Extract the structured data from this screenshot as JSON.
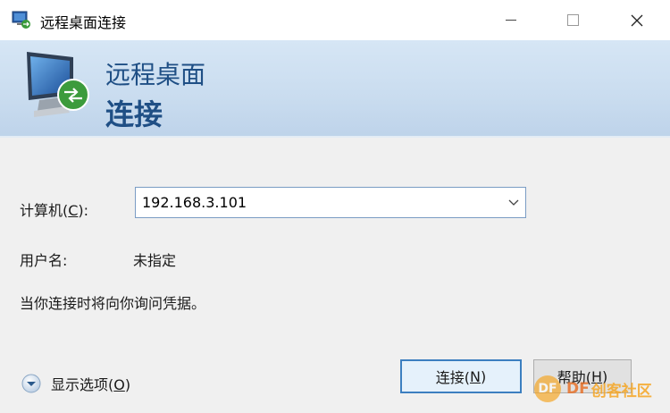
{
  "window": {
    "title": "远程桌面连接",
    "icon": "remote-desktop-icon",
    "controls": {
      "minimize": "minimize-icon",
      "maximize": "maximize-icon",
      "close": "close-icon"
    }
  },
  "banner": {
    "line1": "远程桌面",
    "line2": "连接",
    "icon": "monitor-connection-icon"
  },
  "form": {
    "computer_label": "计算机(",
    "computer_accel": "C",
    "computer_label_end": "):",
    "computer_value": "192.168.3.101",
    "user_label": "用户名:",
    "user_value": "未指定",
    "note": "当你连接时将向你询问凭据。"
  },
  "options": {
    "label_prefix": "显示选项(",
    "accel": "O",
    "label_suffix": ")"
  },
  "buttons": {
    "connect_prefix": "连接(",
    "connect_accel": "N",
    "connect_suffix": ")",
    "help_prefix": "帮助(",
    "help_accel": "H",
    "help_suffix": ")"
  },
  "watermark": {
    "logo": "DF",
    "brand": "DF",
    "text": "创客社区"
  },
  "colors": {
    "banner_text": "#1f4f85",
    "accent_border": "#3c7fc0",
    "watermark": "#f6a623"
  }
}
